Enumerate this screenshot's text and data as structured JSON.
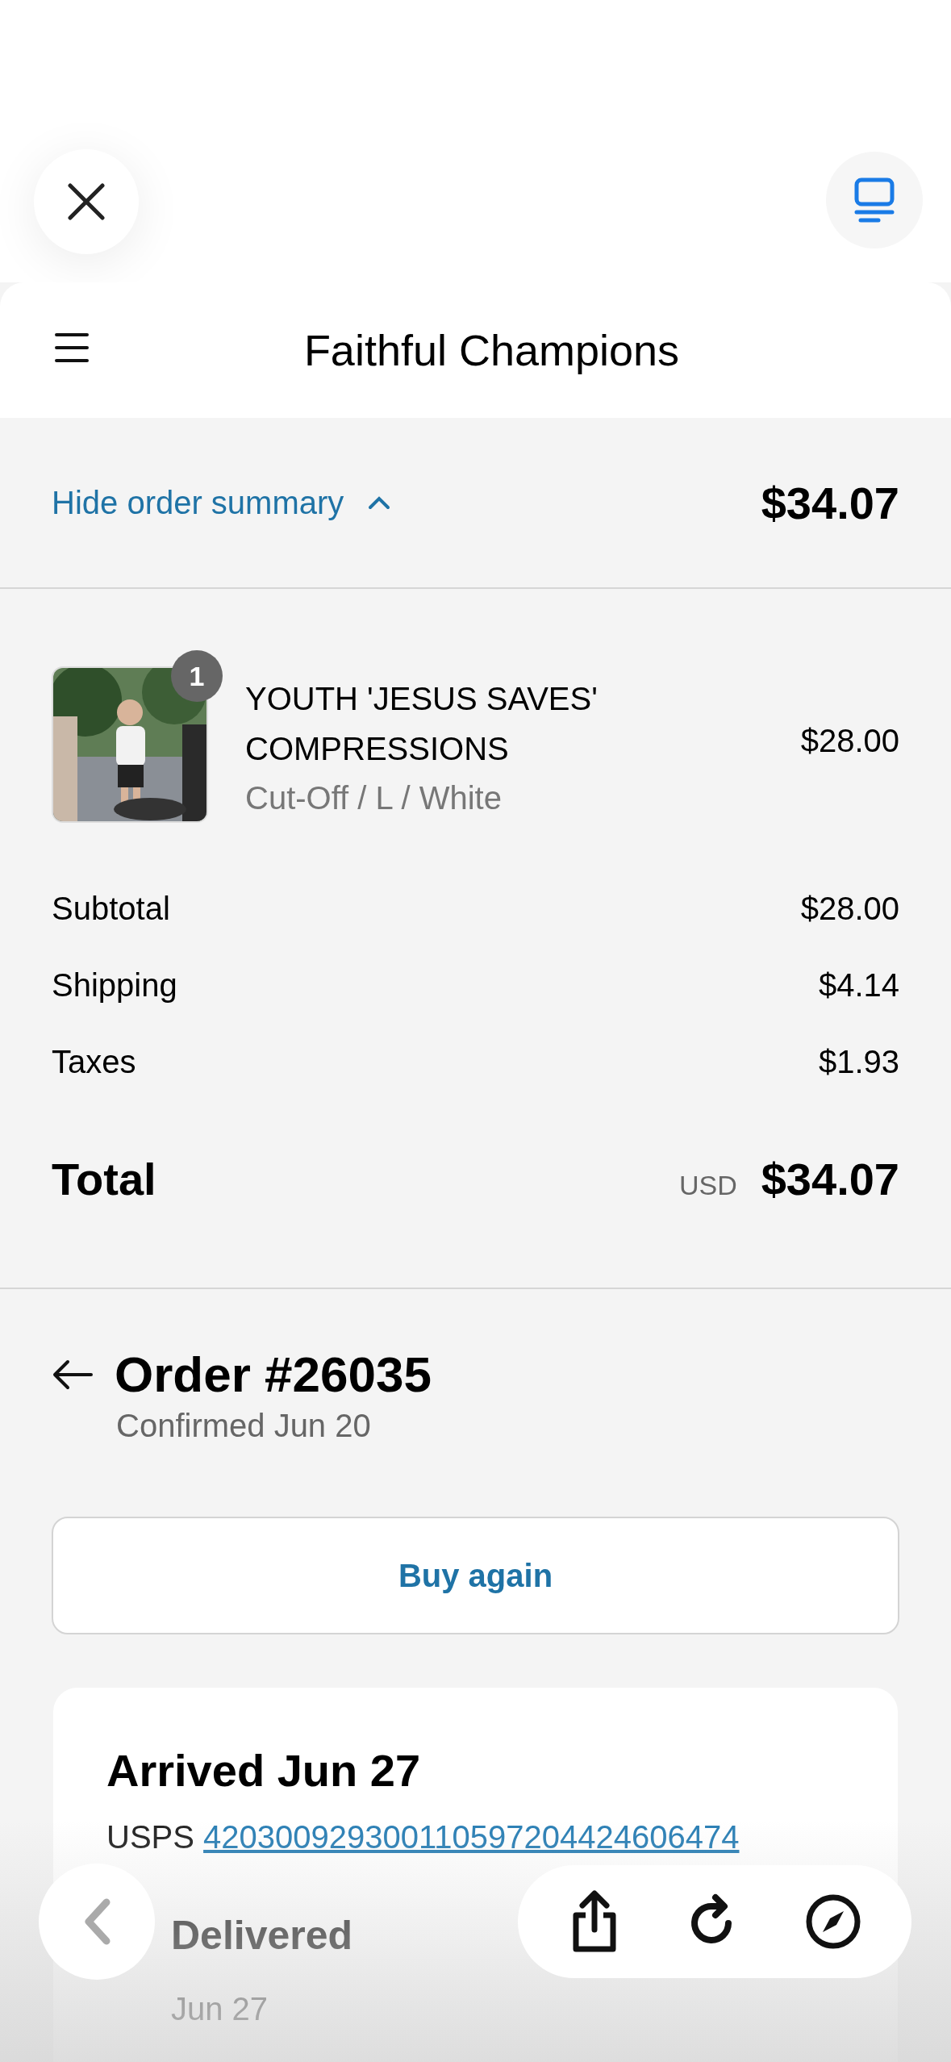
{
  "header": {
    "title": "Faithful Champions"
  },
  "summary_bar": {
    "toggle_label": "Hide order summary",
    "expanded": true,
    "total": "$34.07"
  },
  "line_items": [
    {
      "quantity": "1",
      "name": "YOUTH 'JESUS SAVES' COMPRESSIONS",
      "variant": "Cut-Off / L / White",
      "price": "$28.00"
    }
  ],
  "costs": [
    {
      "label": "Subtotal",
      "value": "$28.00"
    },
    {
      "label": "Shipping",
      "value": "$4.14"
    },
    {
      "label": "Taxes",
      "value": "$1.93"
    }
  ],
  "total": {
    "label": "Total",
    "currency": "USD",
    "value": "$34.07"
  },
  "order": {
    "title": "Order #26035",
    "subtitle": "Confirmed Jun 20",
    "action": "Buy again"
  },
  "shipment": {
    "status": "Arrived Jun 27",
    "carrier": "USPS",
    "tracking": "420300929300110597204424606474",
    "timeline": [
      {
        "label": "Delivered",
        "date": "Jun 27"
      }
    ]
  }
}
